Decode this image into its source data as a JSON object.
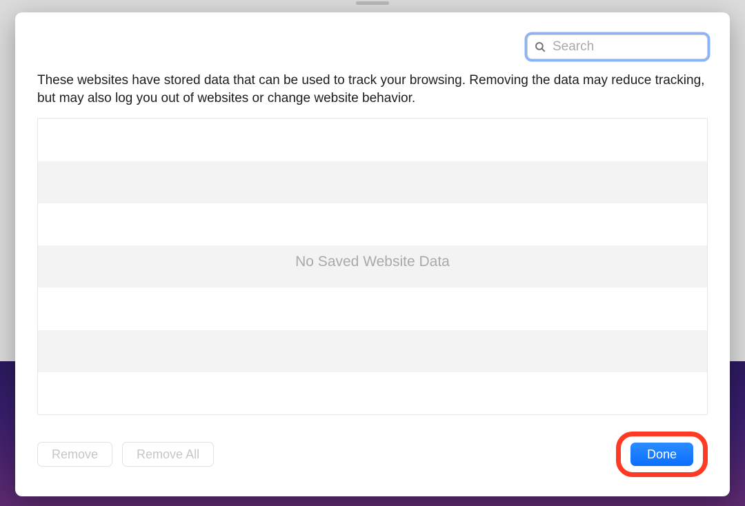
{
  "search": {
    "placeholder": "Search",
    "value": ""
  },
  "description": "These websites have stored data that can be used to track your browsing. Removing the data may reduce tracking, but may also log you out of websites or change website behavior.",
  "list": {
    "empty_message": "No Saved Website Data"
  },
  "buttons": {
    "remove": "Remove",
    "remove_all": "Remove All",
    "done": "Done"
  }
}
